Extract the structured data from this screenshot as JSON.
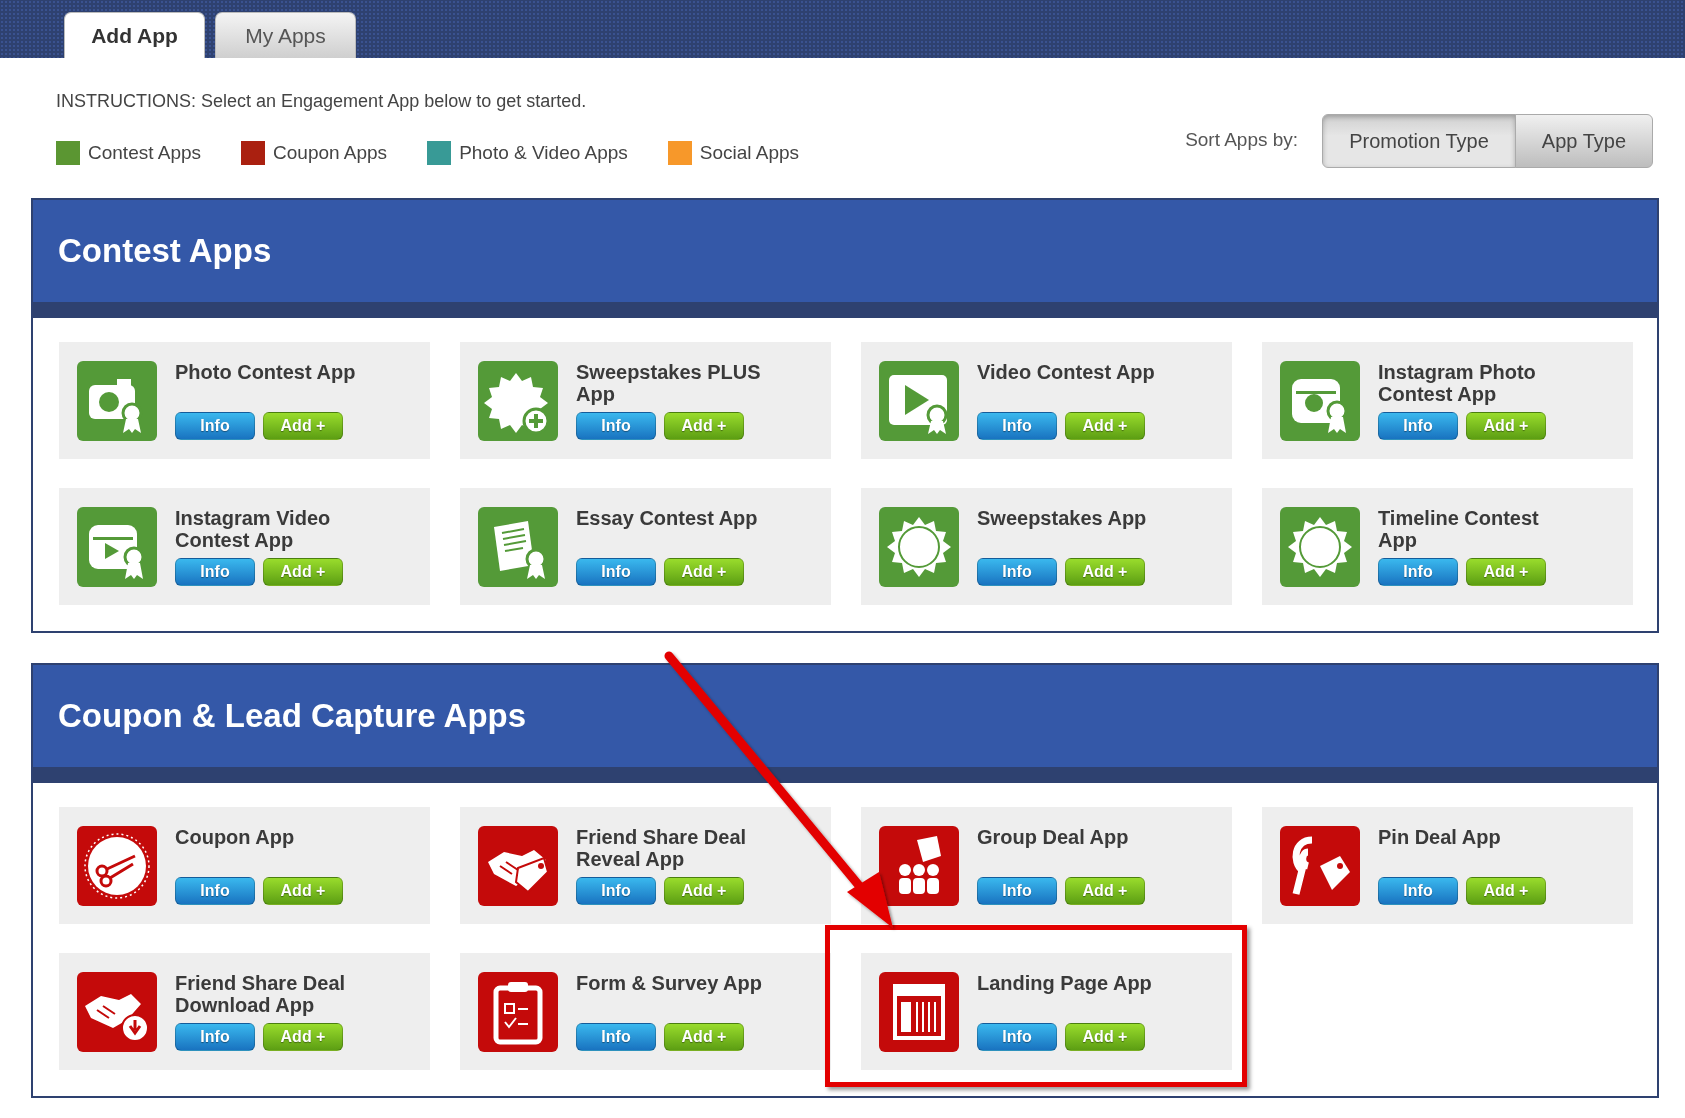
{
  "tabs": [
    {
      "label": "Add App",
      "selected": true
    },
    {
      "label": "My Apps",
      "selected": false
    }
  ],
  "instructions": "INSTRUCTIONS: Select an Engagement App below to get started.",
  "legend": [
    {
      "label": "Contest Apps",
      "color": "#5b9632"
    },
    {
      "label": "Coupon Apps",
      "color": "#aa2010"
    },
    {
      "label": "Photo & Video Apps",
      "color": "#389a96"
    },
    {
      "label": "Social Apps",
      "color": "#f7982a"
    }
  ],
  "sort": {
    "label": "Sort Apps by:",
    "options": [
      {
        "label": "Promotion Type",
        "selected": true
      },
      {
        "label": "App Type",
        "selected": false
      }
    ]
  },
  "sections": [
    {
      "title": "Contest Apps",
      "color": "#549a38",
      "apps": [
        {
          "name": "Photo Contest App",
          "kind": "camera",
          "buttons": [
            "Info",
            "Add +"
          ],
          "highlighted": false
        },
        {
          "name": "Sweepstakes PLUS App",
          "kind": "win-plus",
          "buttons": [
            "Info",
            "Add +"
          ],
          "highlighted": false
        },
        {
          "name": "Video Contest App",
          "kind": "video",
          "buttons": [
            "Info",
            "Add +"
          ],
          "highlighted": false
        },
        {
          "name": "Instagram Photo Contest App",
          "kind": "insta-photo",
          "buttons": [
            "Info",
            "Add +"
          ],
          "highlighted": false
        },
        {
          "name": "Instagram Video Contest App",
          "kind": "insta-video",
          "buttons": [
            "Info",
            "Add +"
          ],
          "highlighted": false
        },
        {
          "name": "Essay Contest App",
          "kind": "essay",
          "buttons": [
            "Info",
            "Add +"
          ],
          "highlighted": false
        },
        {
          "name": "Sweepstakes App",
          "kind": "win",
          "buttons": [
            "Info",
            "Add +"
          ],
          "highlighted": false
        },
        {
          "name": "Timeline Contest App",
          "kind": "win",
          "buttons": [
            "Info",
            "Add +"
          ],
          "highlighted": false
        }
      ]
    },
    {
      "title": "Coupon & Lead Capture Apps",
      "color": "#c40a0a",
      "apps": [
        {
          "name": "Coupon App",
          "kind": "scissors",
          "buttons": [
            "Info",
            "Add +"
          ],
          "highlighted": false
        },
        {
          "name": "Friend Share Deal Reveal App",
          "kind": "handshake",
          "buttons": [
            "Info",
            "Add +"
          ],
          "highlighted": false
        },
        {
          "name": "Group Deal App",
          "kind": "group",
          "buttons": [
            "Info",
            "Add +"
          ],
          "highlighted": false
        },
        {
          "name": "Pin Deal App",
          "kind": "pin",
          "buttons": [
            "Info",
            "Add +"
          ],
          "highlighted": false
        },
        {
          "name": "Friend Share Deal Download App",
          "kind": "handshake-download",
          "buttons": [
            "Info",
            "Add +"
          ],
          "highlighted": false
        },
        {
          "name": "Form & Survey App",
          "kind": "form",
          "buttons": [
            "Info",
            "Add +"
          ],
          "highlighted": false
        },
        {
          "name": "Landing Page App",
          "kind": "landing",
          "buttons": [
            "Info",
            "Add +"
          ],
          "highlighted": true
        }
      ]
    }
  ]
}
